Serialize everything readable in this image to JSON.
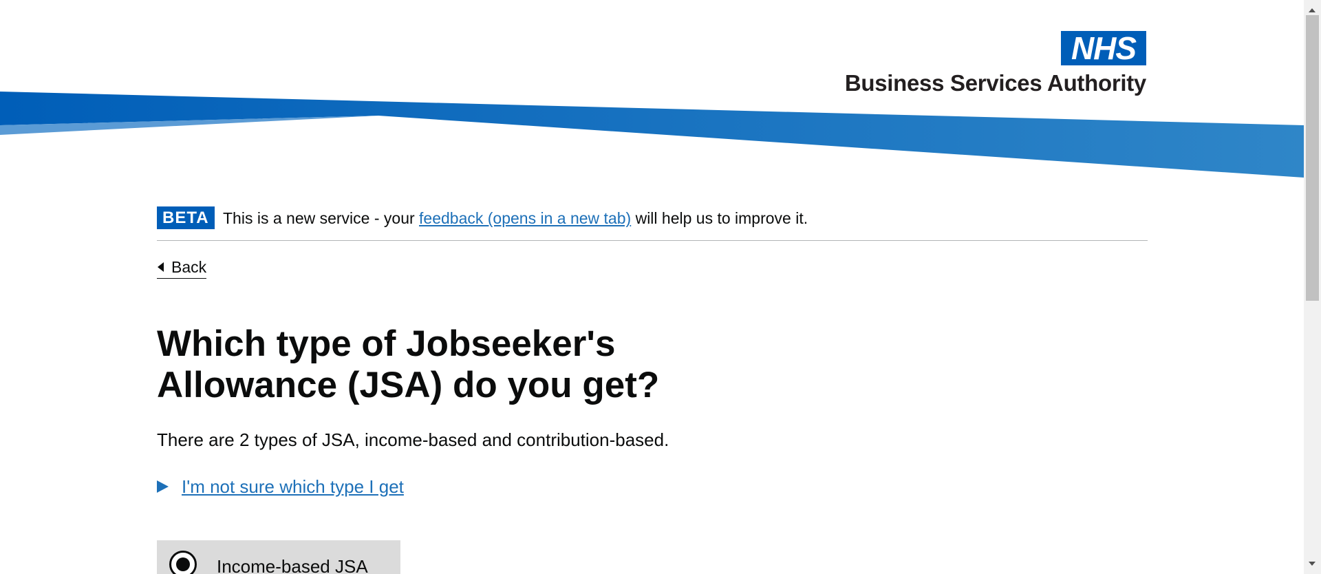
{
  "header": {
    "logo_text": "NHS",
    "org_name": "Business Services Authority",
    "brand_color": "#005eb8"
  },
  "phase_banner": {
    "tag": "BETA",
    "text_before": "This is a new service - your ",
    "link_text": "feedback (opens in a new tab)",
    "text_after": " will help us to improve it."
  },
  "back_link": {
    "label": "Back",
    "icon": "chevron-left-icon"
  },
  "main": {
    "heading_line1": "Which type of Jobseeker's",
    "heading_line2": "Allowance (JSA) do you get?",
    "lead": "There are 2 types of JSA, income-based and contribution-based.",
    "details_summary": "I'm not sure which type I get",
    "details_icon": "triangle-right-icon",
    "options": [
      {
        "label": "Income-based JSA",
        "selected": true
      }
    ]
  },
  "colors": {
    "link": "#1d70b8",
    "text": "#0b0c0c",
    "selected_option_bg": "#dbdbdb"
  }
}
